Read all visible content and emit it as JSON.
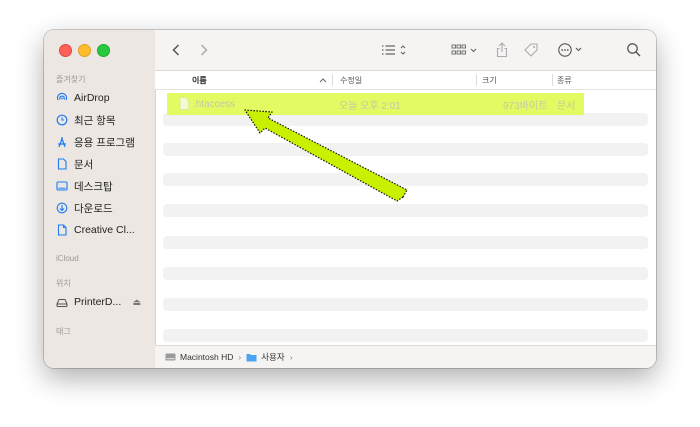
{
  "sidebar": {
    "favorites_label": "즐겨찾기",
    "favorites": [
      {
        "label": "AirDrop",
        "icon": "airdrop-icon"
      },
      {
        "label": "최근 항목",
        "icon": "clock-icon"
      },
      {
        "label": "응용 프로그램",
        "icon": "applications-icon"
      },
      {
        "label": "문서",
        "icon": "document-icon"
      },
      {
        "label": "데스크탑",
        "icon": "desktop-icon"
      },
      {
        "label": "다운로드",
        "icon": "download-icon"
      },
      {
        "label": "Creative Cl...",
        "icon": "file-icon"
      }
    ],
    "icloud_label": "iCloud",
    "locations_label": "위치",
    "locations": [
      {
        "label": "PrinterD...",
        "icon": "disk-icon",
        "eject": "⏏"
      }
    ],
    "tags_label": "태그"
  },
  "columns": {
    "name": "이름",
    "modified": "수정일",
    "size": "크기",
    "kind": "종류"
  },
  "file": {
    "name": ".htaccess",
    "modified": "오늘 오후 2:01",
    "size": "973바이트",
    "kind": "문서"
  },
  "pathbar": {
    "disk": "Macintosh HD",
    "folder": "사용자"
  },
  "colors": {
    "highlight": "#e3fa62",
    "arrow": "#c8f000"
  }
}
